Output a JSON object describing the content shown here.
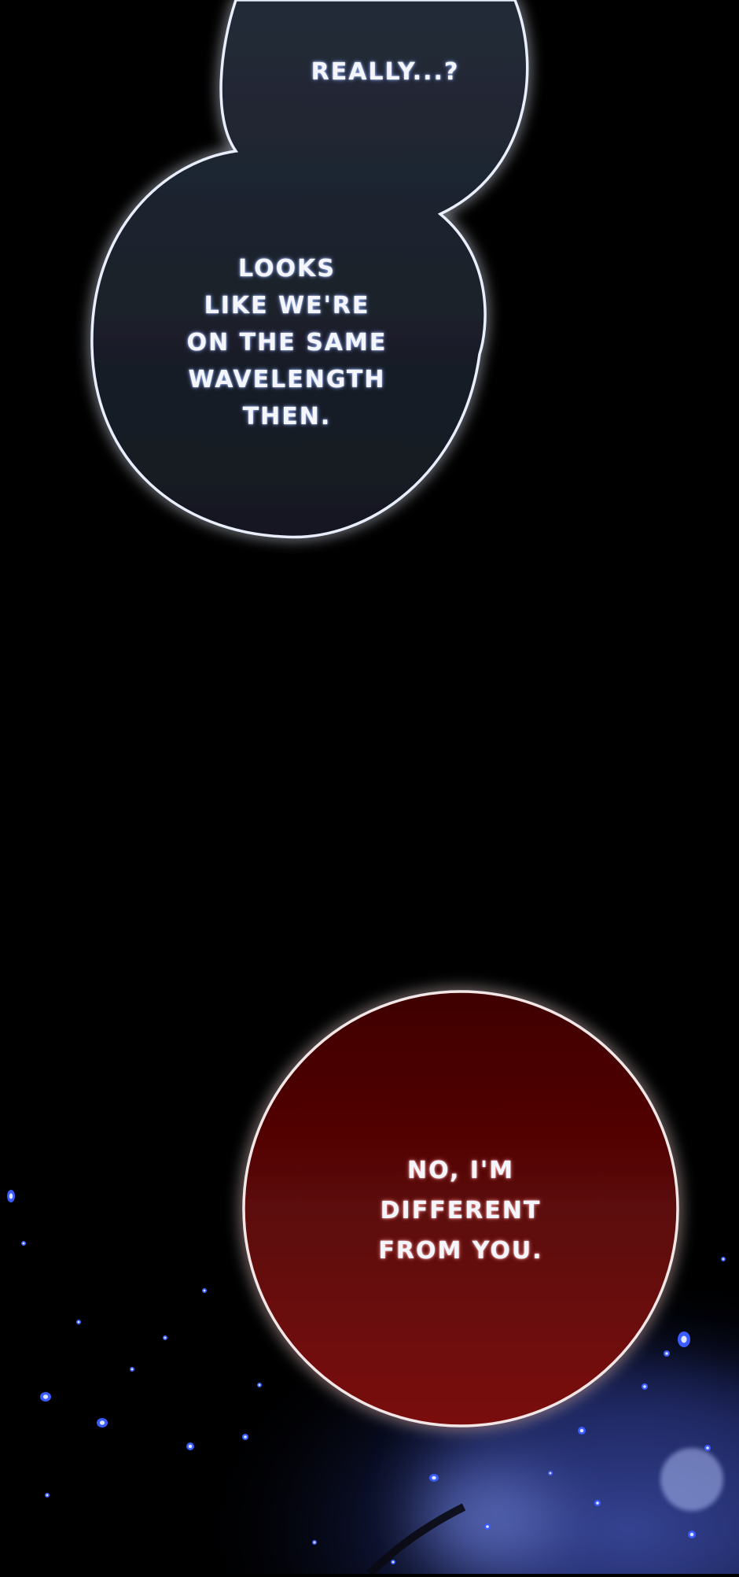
{
  "panel": {
    "bubble_top": {
      "lines": [
        "REALLY...?"
      ]
    },
    "bubble_middle": {
      "lines": [
        "LOOKS",
        "LIKE WE'RE",
        "ON THE SAME",
        "WAVELENGTH",
        "THEN."
      ]
    },
    "bubble_red": {
      "lines": [
        "NO, I'M",
        "DIFFERENT",
        "FROM YOU."
      ]
    }
  },
  "colors": {
    "background": "#000000",
    "dark_bubble_fill": "#1e2430",
    "dark_bubble_outline": "#e8eefc",
    "red_bubble_fill": "#5a0505",
    "red_bubble_outline": "#f2e6e6",
    "sparkle": "#3a5cff"
  }
}
